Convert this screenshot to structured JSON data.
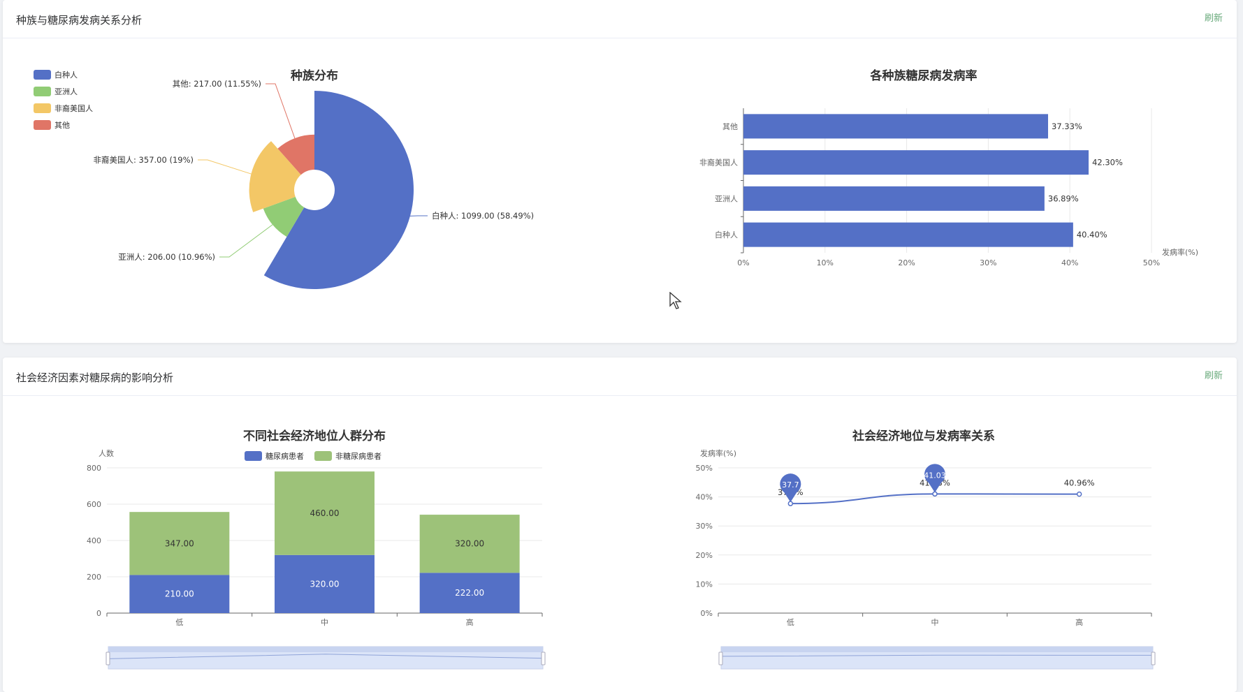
{
  "sections": [
    {
      "title": "种族与糖尿病发病关系分析",
      "refresh_label": "刷新"
    },
    {
      "title": "社会经济因素对糖尿病的影响分析",
      "refresh_label": "刷新"
    }
  ],
  "chart_data": [
    {
      "type": "pie",
      "variant": "rose",
      "title": "种族分布",
      "legend_position": "top-left",
      "labels": [
        "白种人",
        "亚洲人",
        "非裔美国人",
        "其他"
      ],
      "values": [
        1099.0,
        206.0,
        357.0,
        217.0
      ],
      "percents": [
        "58.49%",
        "10.96%",
        "19%",
        "11.55%"
      ],
      "data_labels": [
        "白种人: 1099.00 (58.49%)",
        "亚洲人: 206.00 (10.96%)",
        "非裔美国人: 357.00 (19%)",
        "其他: 217.00 (11.55%)"
      ],
      "colors": [
        "#5470c6",
        "#91cc75",
        "#f3c766",
        "#e07566"
      ]
    },
    {
      "type": "bar",
      "orientation": "horizontal",
      "title": "各种族糖尿病发病率",
      "xlabel": "发病率(%)",
      "categories": [
        "白种人",
        "亚洲人",
        "非裔美国人",
        "其他"
      ],
      "values": [
        40.4,
        36.89,
        42.3,
        37.33
      ],
      "data_labels": [
        "40.40%",
        "36.89%",
        "42.30%",
        "37.33%"
      ],
      "xlim": [
        0,
        50
      ],
      "x_ticks": [
        "0%",
        "10%",
        "20%",
        "30%",
        "40%",
        "50%"
      ],
      "color": "#5470c6",
      "grid": true
    },
    {
      "type": "bar",
      "stacked": true,
      "title": "不同社会经济地位人群分布",
      "ylabel": "人数",
      "categories": [
        "低",
        "中",
        "高"
      ],
      "series": [
        {
          "name": "糖尿病患者",
          "values": [
            210,
            320,
            222
          ],
          "color": "#5470c6"
        },
        {
          "name": "非糖尿病患者",
          "values": [
            347,
            460,
            320
          ],
          "color": "#9dc279"
        }
      ],
      "data_labels": [
        [
          "210.00",
          "320.00",
          "222.00"
        ],
        [
          "347.00",
          "460.00",
          "320.00"
        ]
      ],
      "ylim": [
        0,
        800
      ],
      "y_ticks": [
        "0",
        "200",
        "400",
        "600",
        "800"
      ],
      "legend_position": "top",
      "grid": true,
      "data_zoom": true
    },
    {
      "type": "line",
      "smooth": true,
      "title": "社会经济地位与发病率关系",
      "ylabel": "发病率(%)",
      "categories": [
        "低",
        "中",
        "高"
      ],
      "values": [
        37.7,
        41.03,
        40.96
      ],
      "data_labels": [
        "37.7%",
        "41.03%",
        "40.96%"
      ],
      "markers": [
        {
          "label": "37.7",
          "index": 0
        },
        {
          "label": "41.03",
          "index": 1
        }
      ],
      "ylim": [
        0,
        50
      ],
      "y_ticks": [
        "0%",
        "10%",
        "20%",
        "30%",
        "40%",
        "50%"
      ],
      "color": "#5470c6",
      "grid": true,
      "data_zoom": true
    }
  ]
}
